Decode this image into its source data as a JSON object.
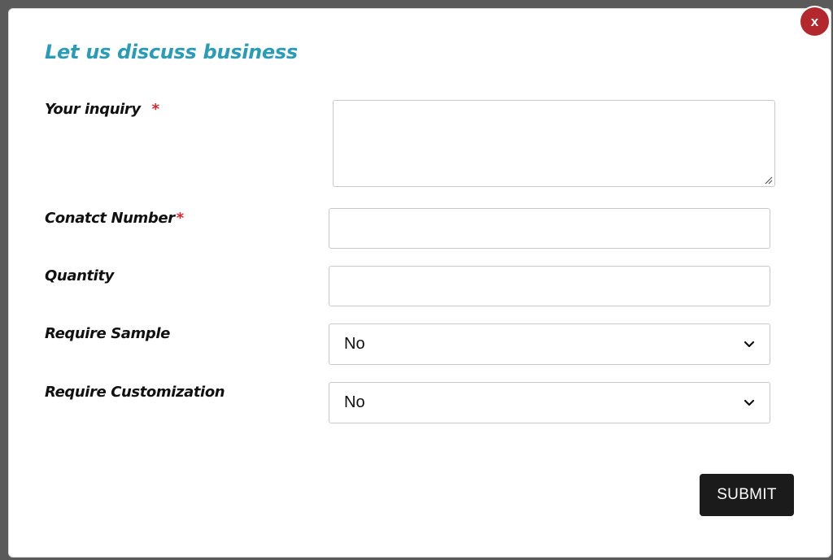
{
  "dialog": {
    "title": "Let us discuss business",
    "close_label": "x"
  },
  "form": {
    "inquiry": {
      "label": "Your inquiry",
      "required_mark": "*",
      "value": ""
    },
    "contact_number": {
      "label": "Conatct Number",
      "required_mark": "*",
      "value": ""
    },
    "quantity": {
      "label": "Quantity",
      "value": ""
    },
    "require_sample": {
      "label": "Require Sample",
      "selected": "No"
    },
    "require_customization": {
      "label": "Require Customization",
      "selected": "No"
    }
  },
  "actions": {
    "submit_label": "SUBMIT"
  },
  "colors": {
    "title": "#2a9cb5",
    "required": "#d6252c",
    "close_button": "#b3282d",
    "submit_button": "#1b1b1b"
  },
  "icons": {
    "select_arrow": "chevron-down-icon",
    "textarea_grip": "resize-grip-icon"
  }
}
